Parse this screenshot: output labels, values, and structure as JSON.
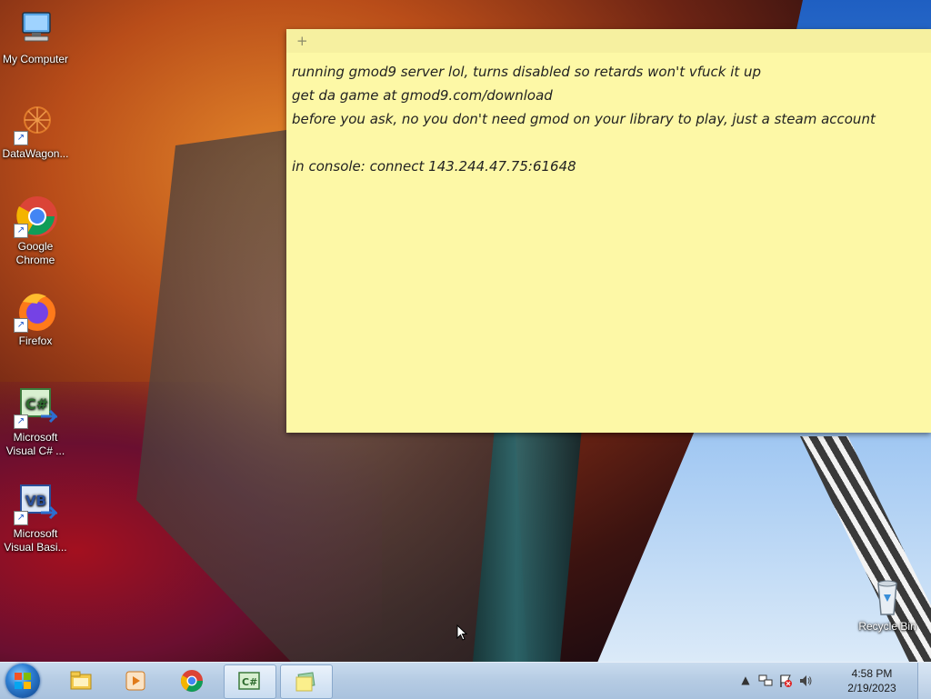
{
  "desktop": {
    "icons": [
      {
        "label": "My Computer",
        "icon": "computer-icon"
      },
      {
        "label": "DataWagon...",
        "icon": "datawagon-icon"
      },
      {
        "label": "Google Chrome",
        "icon": "chrome-icon"
      },
      {
        "label": "Firefox",
        "icon": "firefox-icon"
      },
      {
        "label": "Microsoft Visual C# ...",
        "icon": "visual-csharp-icon"
      },
      {
        "label": "Microsoft Visual Basi...",
        "icon": "visual-basic-icon"
      }
    ],
    "recycle_bin": {
      "label": "Recycle Bin",
      "icon": "recycle-bin-icon"
    }
  },
  "sticky_note": {
    "add_glyph": "+",
    "lines": [
      "running gmod9 server lol, turns disabled so retards won't vfuck it up",
      "get da game at gmod9.com/download",
      "before you ask, no you don't need gmod on your library to play, just a steam account",
      "",
      "in console: connect 143.244.47.75:61648"
    ],
    "background": "#fdf8a6"
  },
  "taskbar": {
    "start": {
      "icon": "windows-start-icon"
    },
    "pinned": [
      {
        "icon": "file-explorer-icon",
        "active": false
      },
      {
        "icon": "media-player-icon",
        "active": false
      },
      {
        "icon": "chrome-icon",
        "active": false
      },
      {
        "icon": "visual-csharp-icon",
        "active": true,
        "text": "C#"
      },
      {
        "icon": "sticky-notes-icon",
        "active": true
      }
    ],
    "tray": {
      "icons": [
        "show-hidden-icons-chevron",
        "network-icon",
        "action-center-flag-icon",
        "volume-icon"
      ],
      "time": "4:58 PM",
      "date": "2/19/2023"
    }
  }
}
